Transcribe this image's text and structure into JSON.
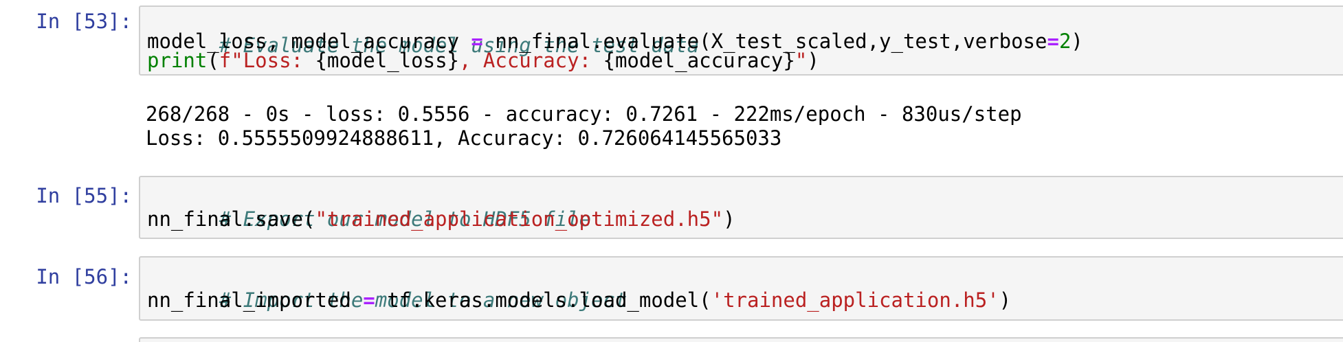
{
  "cells": [
    {
      "prompt": "In [53]:",
      "lines": [
        {
          "comment": "# Evaluate the model using the test data"
        },
        {
          "t1": "model_loss, model_accuracy ",
          "op": "=",
          "t2": " nn_final.evaluate(X_test_scaled,y_test,verbose",
          "op2": "=",
          "num": "2",
          "t3": ")"
        },
        {
          "fn": "print",
          "p1": "(",
          "s1": "f\"Loss: ",
          "v1": "{model_loss}",
          "s2": ", Accuracy: ",
          "v2": "{model_accuracy}",
          "s3": "\"",
          "p2": ")"
        }
      ],
      "output": [
        "268/268 - 0s - loss: 0.5556 - accuracy: 0.7261 - 222ms/epoch - 830us/step",
        "Loss: 0.5555509924888611, Accuracy: 0.726064145565033"
      ]
    },
    {
      "prompt": "In [55]:",
      "lines": [
        {
          "comment": "# Export our model to HDF5 file"
        },
        {
          "t1": "nn_final.save(",
          "str": "\"trained_application_optimized.h5\"",
          "t2": ")"
        }
      ]
    },
    {
      "prompt": "In [56]:",
      "lines": [
        {
          "comment": "# Import the model to a new object"
        },
        {
          "t1": "nn_final_imported ",
          "op": "=",
          "t2": " tf.keras.models.load_model(",
          "str": "'trained_application.h5'",
          "t3": ")"
        }
      ]
    }
  ],
  "colors": {
    "prompt": "#303f9f",
    "comment": "#3d7a7a",
    "operator": "#aa22ff",
    "number_builtin": "#008000",
    "string": "#ba2121",
    "cell_bg": "#f5f5f5",
    "cell_border": "#cfcfcf"
  }
}
